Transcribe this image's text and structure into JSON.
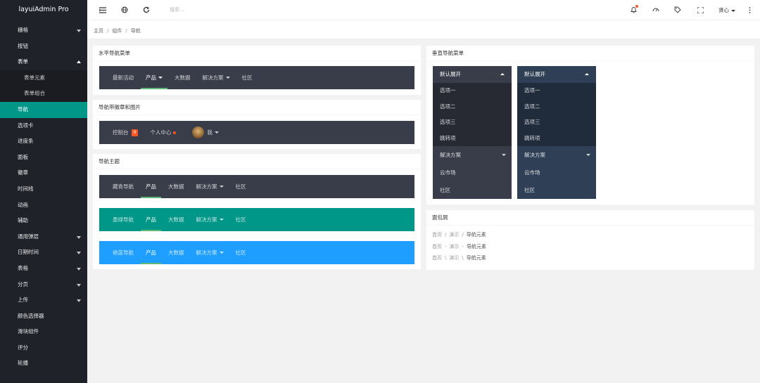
{
  "app": {
    "title": "layuiAdmin Pro"
  },
  "sidebar": {
    "items": [
      {
        "label": "栅格",
        "caret": "down"
      },
      {
        "label": "按钮"
      },
      {
        "label": "表单",
        "caret": "up"
      },
      {
        "label": "表单元素",
        "sub": true
      },
      {
        "label": "表单组合",
        "sub": true
      },
      {
        "label": "导航",
        "active": true
      },
      {
        "label": "选项卡"
      },
      {
        "label": "进度条"
      },
      {
        "label": "面板"
      },
      {
        "label": "徽章"
      },
      {
        "label": "时间线"
      },
      {
        "label": "动画"
      },
      {
        "label": "辅助"
      },
      {
        "label": "通用弹层",
        "caret": "down"
      },
      {
        "label": "日期时间",
        "caret": "down"
      },
      {
        "label": "表格",
        "caret": "down"
      },
      {
        "label": "分页",
        "caret": "down"
      },
      {
        "label": "上传",
        "caret": "down"
      },
      {
        "label": "颜色选择器"
      },
      {
        "label": "滑块组件"
      },
      {
        "label": "评分"
      },
      {
        "label": "轮播"
      }
    ]
  },
  "header": {
    "search_placeholder": "搜索...",
    "user_name": "贤心",
    "icons": [
      "menu-fold-icon",
      "globe-icon",
      "refresh-icon",
      "bell-icon",
      "theme-icon",
      "tag-icon",
      "fullscreen-icon",
      "more-icon"
    ]
  },
  "breadcrumb": {
    "items": [
      "主页",
      "组件",
      "导航"
    ],
    "separator": "/"
  },
  "cards": {
    "horizontal": {
      "title": "水平导航菜单",
      "items": [
        "最新活动",
        "产品",
        "大数据",
        "解决方案",
        "社区"
      ]
    },
    "badges": {
      "title": "导航带徽章和图片",
      "console": "控制台",
      "badge": "9",
      "center": "个人中心",
      "me": "我"
    },
    "themes": {
      "title": "导航主题",
      "navs": [
        {
          "name": "藏青导航",
          "color": "#393d49"
        },
        {
          "name": "墨绿导航",
          "color": "#009688"
        },
        {
          "name": "艳蓝导航",
          "color": "#1e9fff"
        }
      ],
      "items": [
        "产品",
        "大数据",
        "解决方案",
        "社区"
      ]
    },
    "vertical": {
      "title": "垂直导航菜单",
      "header": "默认展开",
      "items": [
        "选项一",
        "选项二",
        "选项三",
        "跳转项"
      ],
      "group": "解决方案",
      "tail": [
        "云市场",
        "社区"
      ],
      "colors": [
        "#393d49",
        "#2f4056"
      ]
    },
    "breadcrumbs": {
      "title": "面包屑",
      "items": [
        "首页",
        "演示",
        "导航元素"
      ],
      "separators": [
        "/",
        "-",
        "\\"
      ]
    }
  }
}
